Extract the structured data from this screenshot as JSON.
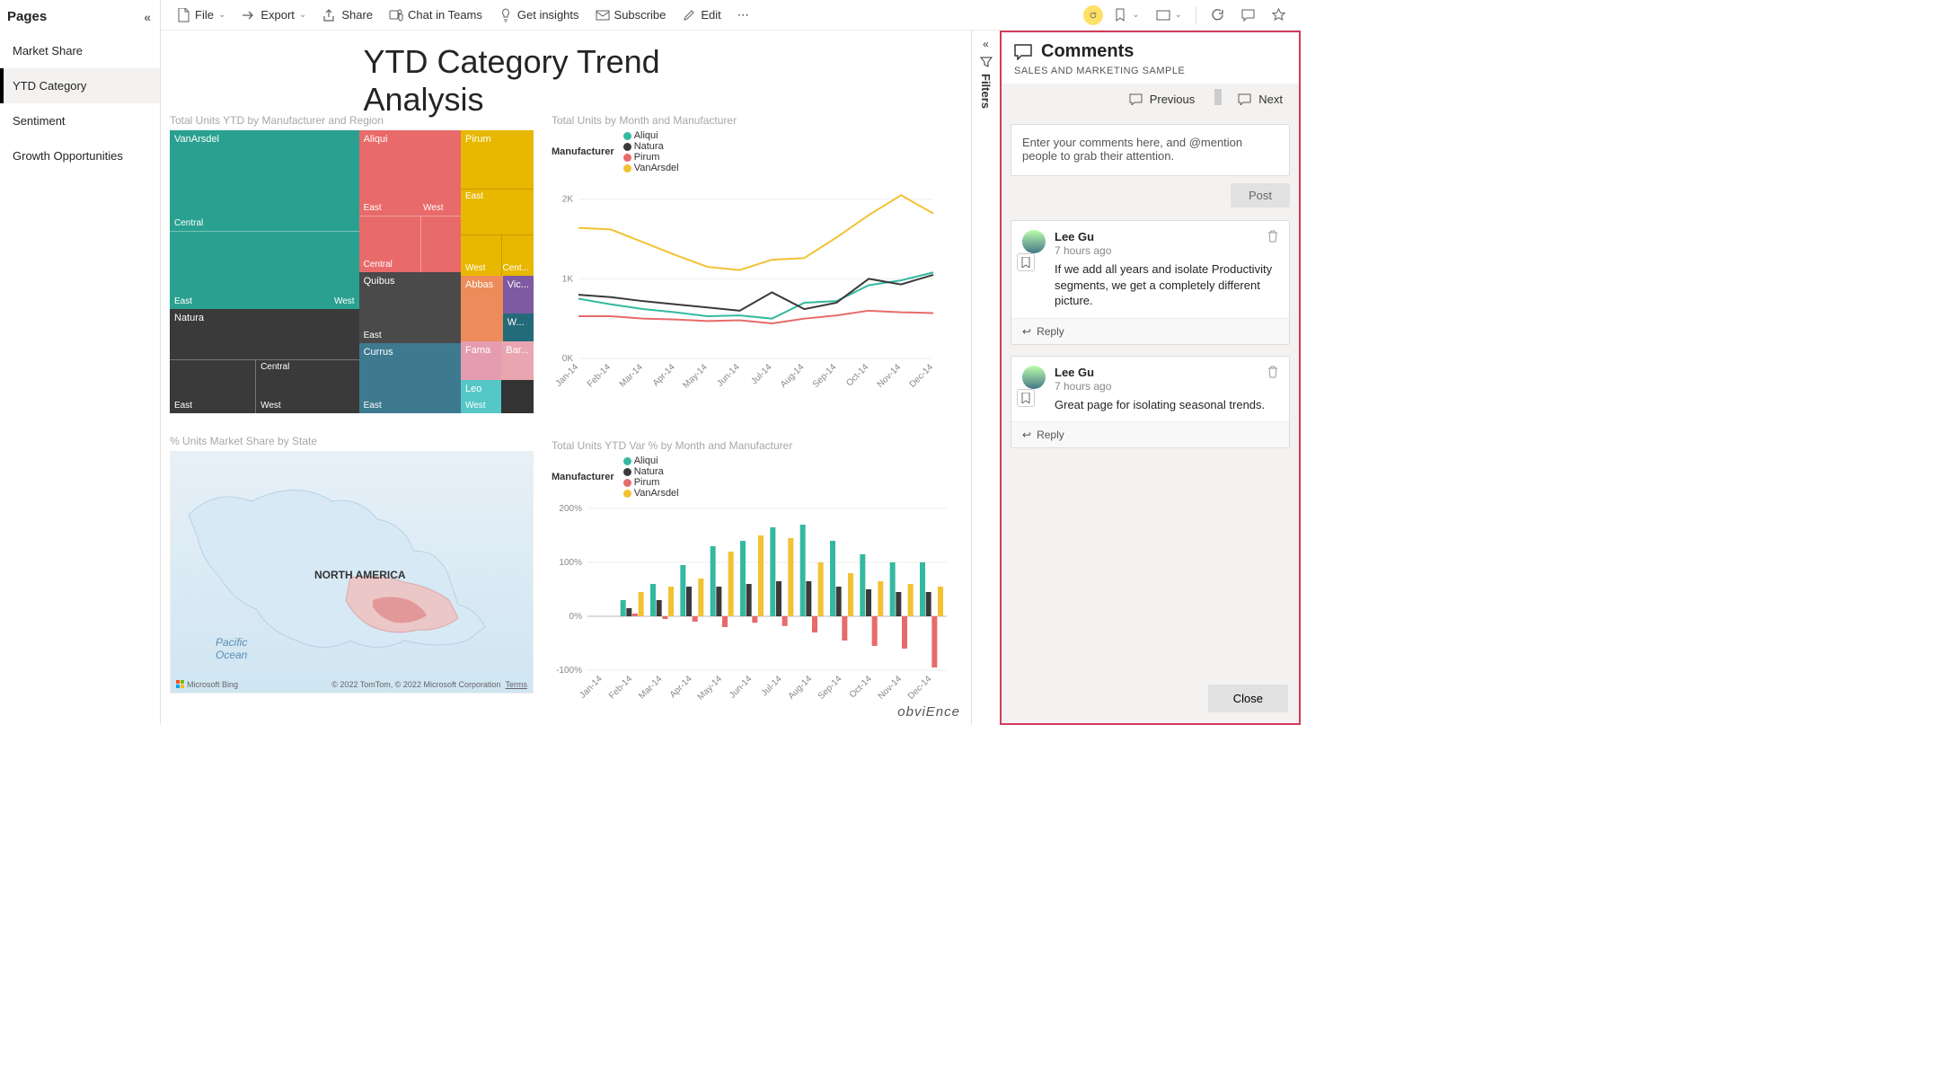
{
  "sidebar": {
    "title": "Pages",
    "items": [
      {
        "label": "Market Share",
        "active": false
      },
      {
        "label": "YTD Category",
        "active": true
      },
      {
        "label": "Sentiment",
        "active": false
      },
      {
        "label": "Growth Opportunities",
        "active": false
      }
    ]
  },
  "toolbar": {
    "file": "File",
    "export": "Export",
    "share": "Share",
    "chat": "Chat in Teams",
    "insights": "Get insights",
    "subscribe": "Subscribe",
    "edit": "Edit"
  },
  "report": {
    "title": "YTD Category Trend Analysis",
    "footer": "obviEnce"
  },
  "treemap": {
    "title": "Total Units YTD by Manufacturer and Region",
    "labels": {
      "vanarsdel": "VanArsdel",
      "east": "East",
      "central": "Central",
      "west": "West",
      "natura": "Natura",
      "aliqui": "Aliqui",
      "quibus": "Quibus",
      "currus": "Currus",
      "pirum": "Pirum",
      "abbas": "Abbas",
      "fama": "Fama",
      "leo": "Leo",
      "victoria": "Vic...",
      "barba": "Bar...",
      "salvus": "W...",
      "cent": "Cent..."
    }
  },
  "linechart": {
    "title": "Total Units by Month and Manufacturer",
    "legend_label": "Manufacturer",
    "legend": [
      "Aliqui",
      "Natura",
      "Pirum",
      "VanArsdel"
    ],
    "yticks": [
      "0K",
      "1K",
      "2K"
    ]
  },
  "map": {
    "title": "% Units Market Share by State",
    "label_na": "NORTH AMERICA",
    "label_ocean": "Pacific\nOcean",
    "bing": "Microsoft Bing",
    "credit": "© 2022 TomTom, © 2022 Microsoft Corporation",
    "terms": "Terms"
  },
  "barchart": {
    "title": "Total Units YTD Var % by Month and Manufacturer",
    "legend_label": "Manufacturer",
    "legend": [
      "Aliqui",
      "Natura",
      "Pirum",
      "VanArsdel"
    ],
    "yticks": [
      "-100%",
      "0%",
      "100%",
      "200%"
    ]
  },
  "months": [
    "Jan-14",
    "Feb-14",
    "Mar-14",
    "Apr-14",
    "May-14",
    "Jun-14",
    "Jul-14",
    "Aug-14",
    "Sep-14",
    "Oct-14",
    "Nov-14",
    "Dec-14"
  ],
  "chart_data": [
    {
      "type": "line",
      "title": "Total Units by Month and Manufacturer",
      "x": [
        "Jan-14",
        "Feb-14",
        "Mar-14",
        "Apr-14",
        "May-14",
        "Jun-14",
        "Jul-14",
        "Aug-14",
        "Sep-14",
        "Oct-14",
        "Nov-14",
        "Dec-14"
      ],
      "series": [
        {
          "name": "Aliqui",
          "color": "#34b9a0",
          "values": [
            750,
            680,
            620,
            580,
            530,
            540,
            500,
            700,
            720,
            920,
            980,
            1080
          ]
        },
        {
          "name": "Natura",
          "color": "#3a3a3a",
          "values": [
            800,
            770,
            720,
            680,
            640,
            600,
            830,
            620,
            700,
            1000,
            930,
            1050
          ]
        },
        {
          "name": "Pirum",
          "color": "#e86a6a",
          "values": [
            530,
            530,
            500,
            490,
            470,
            480,
            440,
            500,
            540,
            600,
            580,
            570
          ]
        },
        {
          "name": "VanArsdel",
          "color": "#f2c232",
          "values": [
            1640,
            1620,
            1460,
            1300,
            1150,
            1110,
            1240,
            1260,
            1520,
            1800,
            2050,
            1820
          ]
        }
      ],
      "ylabel": "",
      "ylim": [
        0,
        2200
      ]
    },
    {
      "type": "bar",
      "title": "Total Units YTD Var % by Month and Manufacturer",
      "x": [
        "Jan-14",
        "Feb-14",
        "Mar-14",
        "Apr-14",
        "May-14",
        "Jun-14",
        "Jul-14",
        "Aug-14",
        "Sep-14",
        "Oct-14",
        "Nov-14",
        "Dec-14"
      ],
      "series": [
        {
          "name": "Aliqui",
          "color": "#34b9a0",
          "values": [
            0,
            30,
            60,
            95,
            130,
            140,
            165,
            170,
            140,
            115,
            100,
            100
          ]
        },
        {
          "name": "Natura",
          "color": "#3a3a3a",
          "values": [
            0,
            15,
            30,
            55,
            55,
            60,
            65,
            65,
            55,
            50,
            45,
            45
          ]
        },
        {
          "name": "Pirum",
          "color": "#e86a6a",
          "values": [
            0,
            5,
            -5,
            -10,
            -20,
            -12,
            -18,
            -30,
            -45,
            -55,
            -60,
            -95
          ]
        },
        {
          "name": "VanArsdel",
          "color": "#f2c232",
          "values": [
            0,
            45,
            55,
            70,
            120,
            150,
            145,
            100,
            80,
            65,
            60,
            55
          ]
        }
      ],
      "ylabel": "",
      "ylim": [
        -100,
        200
      ]
    }
  ],
  "filters": {
    "label": "Filters"
  },
  "comments": {
    "title": "Comments",
    "subtitle": "SALES AND MARKETING SAMPLE",
    "prev": "Previous",
    "next": "Next",
    "placeholder": "Enter your comments here, and @mention people to grab their attention.",
    "post": "Post",
    "reply": "Reply",
    "close": "Close",
    "items": [
      {
        "author": "Lee Gu",
        "time": "7 hours ago",
        "text": "If we add all years and isolate Productivity segments, we get a completely different picture."
      },
      {
        "author": "Lee Gu",
        "time": "7 hours ago",
        "text": "Great page for isolating seasonal trends."
      }
    ]
  },
  "colors": {
    "aliqui": "#34b9a0",
    "natura": "#3a3a3a",
    "pirum": "#e86a6a",
    "vanarsdel": "#f2c232",
    "vanarsdel_tm": "#2aa190",
    "aliqui_tm": "#e86a6a",
    "pirum_tm": "#e8b800",
    "quibus": "#4a4a4a",
    "abbas": "#ed8b5a",
    "victoria": "#7e5aa2",
    "currus": "#3d7a8f",
    "fama": "#e59bb0",
    "leo": "#56c7c7",
    "barba": "#e9a5b0",
    "salvus": "#236b7a"
  }
}
